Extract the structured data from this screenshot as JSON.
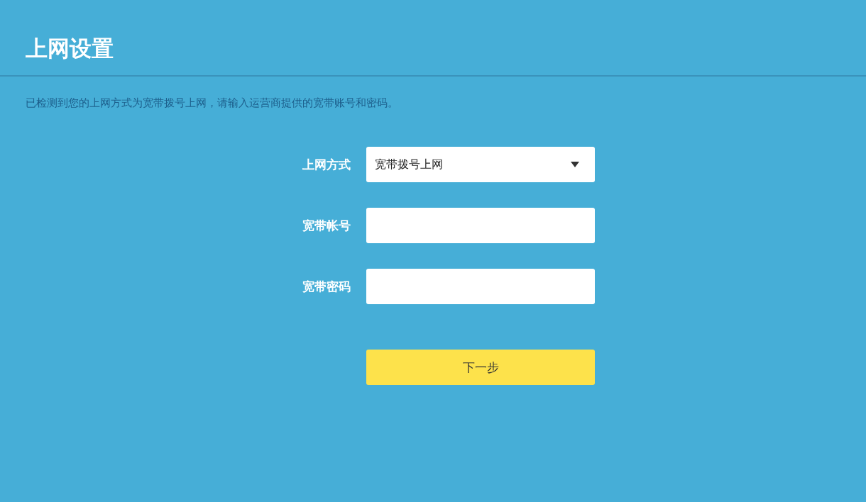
{
  "title": "上网设置",
  "description": "已检测到您的上网方式为宽带拨号上网，请输入运营商提供的宽带账号和密码。",
  "fields": [
    {
      "kind": "select",
      "label": "上网方式",
      "value": "宽带拨号上网"
    },
    {
      "kind": "text",
      "label": "宽带帐号"
    },
    {
      "kind": "password",
      "label": "宽带密码"
    }
  ],
  "next_button": "下一步"
}
